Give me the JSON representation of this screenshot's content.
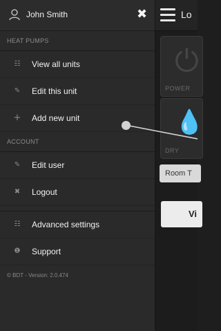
{
  "app": {
    "title_partial": "Lo",
    "tiles": [
      {
        "label": "POWER",
        "icon": "power-icon"
      },
      {
        "label": "DRY",
        "icon": "drop-icon"
      }
    ],
    "room_temp_label": "Room T",
    "view_button_partial": "Vi"
  },
  "drawer": {
    "user_name": "John Smith",
    "close_glyph": "✖",
    "sections": {
      "heat_pumps": "HEAT PUMPS",
      "account": "ACCOUNT"
    },
    "items": {
      "view_all_units": "View all units",
      "edit_this_unit": "Edit this unit",
      "add_new_unit": "Add new unit",
      "edit_user": "Edit user",
      "logout": "Logout",
      "advanced_settings": "Advanced settings",
      "support": "Support"
    },
    "version": "© BDT - Version: 2.0.474"
  }
}
